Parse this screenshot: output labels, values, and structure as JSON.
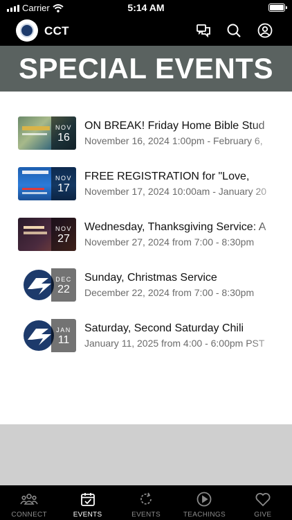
{
  "status_bar": {
    "carrier": "Carrier",
    "time": "5:14 AM"
  },
  "header": {
    "title": "CCT",
    "icons": [
      "chat-icon",
      "search-icon",
      "account-icon"
    ]
  },
  "banner": {
    "title": "SPECIAL EVENTS"
  },
  "events": [
    {
      "month": "NOV",
      "day": "16",
      "title": "ON BREAK! Friday Home Bible Stud",
      "subtitle": "November 16, 2024 1:00pm - February 6,"
    },
    {
      "month": "NOV",
      "day": "17",
      "title": "FREE REGISTRATION for \"Love,",
      "subtitle": "November 17, 2024 10:00am - January 20"
    },
    {
      "month": "NOV",
      "day": "27",
      "title": "Wednesday, Thanksgiving Service: A",
      "subtitle": "November 27, 2024 from 7:00 - 8:30pm"
    },
    {
      "month": "DEC",
      "day": "22",
      "title": "Sunday, Christmas Service",
      "subtitle": "December 22, 2024 from 7:00 - 8:30pm"
    },
    {
      "month": "JAN",
      "day": "11",
      "title": "Saturday, Second Saturday Chili",
      "subtitle": "January 11, 2025 from 4:00 - 6:00pm PST"
    }
  ],
  "tabs": [
    {
      "label": "CONNECT",
      "icon": "people-icon",
      "active": false
    },
    {
      "label": "EVENTS",
      "icon": "calendar-check-icon",
      "active": true
    },
    {
      "label": "EVENTS",
      "icon": "refresh-icon",
      "active": false
    },
    {
      "label": "TEACHINGS",
      "icon": "play-circle-icon",
      "active": false
    },
    {
      "label": "GIVE",
      "icon": "heart-icon",
      "active": false
    }
  ],
  "colors": {
    "banner": "#5a6260",
    "tab_active": "#ffffff",
    "tab_inactive": "#8a8a8a"
  }
}
